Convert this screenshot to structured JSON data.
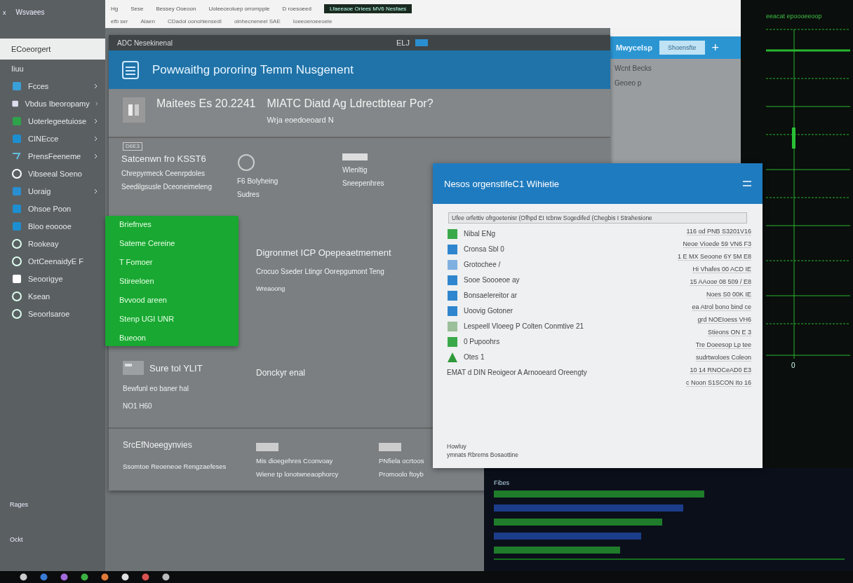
{
  "top_window": {
    "toolbar": [
      "Hg",
      "Sese",
      "Bessey Ooeoon",
      "Uoleeceoluep orrompple",
      "D roesoeed"
    ],
    "address": [
      "efb ser",
      "Alaen",
      "CDadol oonohiensedI",
      "oinhecneneel SAE",
      "Ioeeoeroeeoele"
    ],
    "tab": "Lfaeeaoe Oriees MV6 Nesfaes"
  },
  "sidebar": {
    "title": "Wsvaees",
    "close": "x",
    "items": [
      {
        "label": "ECoeorgert",
        "selected": true,
        "has_submenu": false
      },
      {
        "label": "Iiuu",
        "selected": false,
        "has_submenu": false
      },
      {
        "label": "Fcces",
        "selected": false,
        "has_submenu": true
      },
      {
        "label": "Vbdus Ibeoropamy",
        "selected": false,
        "has_submenu": true
      },
      {
        "label": "Uoterlegeetuiose",
        "selected": false,
        "has_submenu": true
      },
      {
        "label": "CINEcce",
        "selected": false,
        "has_submenu": true
      },
      {
        "label": "PrensFeeneme",
        "selected": false,
        "has_submenu": true
      },
      {
        "label": "Vibseeal Soeno",
        "selected": false,
        "has_submenu": false
      },
      {
        "label": "Uoraig",
        "selected": false,
        "has_submenu": true
      },
      {
        "label": "Ohsoe Poon",
        "selected": false,
        "has_submenu": false
      },
      {
        "label": "Bloo eooooe",
        "selected": false,
        "has_submenu": false
      },
      {
        "label": "Rookeay",
        "selected": false,
        "has_submenu": false
      },
      {
        "label": "OrtCeenaidyE F",
        "selected": false,
        "has_submenu": false
      },
      {
        "label": "Seoorigye",
        "selected": false,
        "has_submenu": false
      },
      {
        "label": "Ksean",
        "selected": false,
        "has_submenu": false
      },
      {
        "label": "Seoorlsaroe",
        "selected": false,
        "has_submenu": false
      }
    ],
    "footer": [
      "Rages",
      "Ockt"
    ]
  },
  "main_window": {
    "title": "ADC Nesekinenal",
    "title_label": "ELJ",
    "header": "Powwaithg pororing Temm Nusgenent",
    "info": {
      "date": "Maitees Es 20.2241",
      "heading": "MIATC Diatd Ag Ldrectbtear Por?",
      "sub": "Wrja eoedoeoard N"
    },
    "tag": "D6E3",
    "cards": [
      {
        "title": "Satcenwn fro KSST6",
        "lines": [
          "Chrepyrmeck Ceenrpdoles",
          "Seedilgsusle Dceoneimeleng"
        ]
      },
      {
        "lines": [
          "F6 Bolyheing",
          "Sudres"
        ]
      },
      {
        "lines": [
          "Wlenltig",
          "Sneepenhres"
        ]
      }
    ],
    "menu": [
      "Briefnves",
      "Sateme Cereine",
      "T Fomoer",
      "Stireeloen",
      "Bvvood areen",
      "Stenp UGI UNR",
      "Bueoon"
    ],
    "left_panel": {
      "title": "Sure tol YLIT",
      "lines": [
        "Bewfunl eo baner hal",
        "NO1 H60"
      ]
    },
    "right_panel": {
      "title": "Digronmet ICP Opepeaetmement",
      "sub": "Crocuo Sseder Ltingr Oorepgumont Teng",
      "note": "Wreaoong",
      "footer": "Donckyr enal"
    },
    "bottom": [
      {
        "title": "SrcEfNoeegynvies",
        "lines": [
          "Ssomtoe Reoeneoe Rengzaefeses"
        ]
      },
      {
        "lines": [
          "Mis dioegehres Cconvoay",
          "Wiene tp lonotwneaophorcy"
        ]
      },
      {
        "lines": [
          "PNfiela ocrtoos",
          "Promoolo ftoyb"
        ]
      }
    ]
  },
  "back_window": {
    "logo": "Mwycelsp",
    "button": "Shoensfte",
    "plus": "+",
    "lines": [
      "Wcnt Becks",
      "Geoeo p"
    ]
  },
  "dialog": {
    "title": "Nesos orgenstifeC1 Wihietie",
    "field": "Ufee orfettiv ofrgoetenisr (Ofhpd EI Icbnw Sogedifed (Chegbis I Strahesione",
    "items": [
      "Nibal ENg",
      "Cronsa Sbl 0",
      "Grotochee /",
      "Sooe Soooeoe ay",
      "Bonsaelereitor ar",
      "Uoovig Gotoner",
      "Lespeell Vloeeg P Colten Conmtive 21",
      "0 Pupoohrs",
      "Otes 1",
      "EMAT d DIN Reoigeor A Arnooeard Oreengty"
    ],
    "values": [
      "116 od PNB S3201V16",
      "Neoe Vioede 59 VN6 F3",
      "1 E MX Seoone 6Y 5M E8",
      "Hi Vhafes 00 ACD IE",
      "15 AAooe 08 509 / E8",
      "Noes S0 00K IE",
      "ea Atrol bono bind ce",
      "grd NOEIoess VH6",
      "Stieons ON E 3",
      "Tre Doeesop Lp tee",
      "sudrtwoloes Coleon",
      "10 14 RNOCeAD0 E3",
      "c Noon S1SCON Ito 16"
    ],
    "footer": [
      "Howluy",
      "ymnats Rbrems Bosaottine"
    ]
  },
  "terminal": {
    "header": "eeacat epoooeeoop",
    "marker": "0",
    "sub": "Fibes"
  }
}
